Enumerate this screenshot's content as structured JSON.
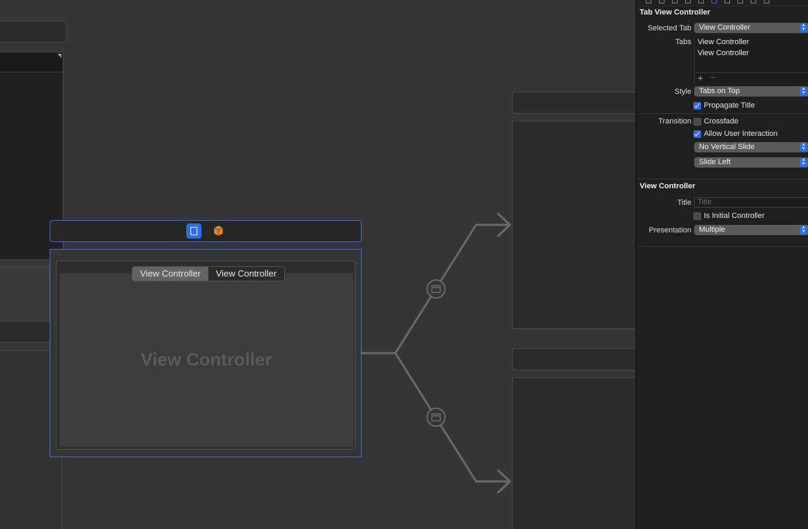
{
  "canvas": {
    "main_scene": {
      "tab_items": [
        "View Controller",
        "View Controller"
      ],
      "selected_tab_index": 0,
      "content_label": "View Controller"
    }
  },
  "inspector": {
    "tab_view_controller": {
      "section_title": "Tab View Controller",
      "selected_tab_label": "Selected Tab",
      "selected_tab_value": "View Controller",
      "tabs_label": "Tabs",
      "tabs": [
        "View Controller",
        "View Controller"
      ],
      "add_symbol": "+",
      "remove_symbol": "−",
      "style_label": "Style",
      "style_value": "Tabs on Top",
      "propagate_title_label": "Propagate Title",
      "propagate_title_checked": true,
      "transition_label": "Transition",
      "crossfade_label": "Crossfade",
      "crossfade_checked": false,
      "allow_user_interaction_label": "Allow User Interaction",
      "allow_user_interaction_checked": true,
      "vertical_slide_value": "No Vertical Slide",
      "horizontal_slide_value": "Slide Left"
    },
    "view_controller": {
      "section_title": "View Controller",
      "title_label": "Title",
      "title_placeholder": "Title",
      "is_initial_label": "Is Initial Controller",
      "is_initial_checked": false,
      "presentation_label": "Presentation",
      "presentation_value": "Multiple"
    }
  },
  "colors": {
    "accent": "#2f6fe4",
    "selection_border": "#3d6ef0",
    "canvas_bg": "#353535",
    "inspector_bg": "#1f1f1f",
    "segue_line": "#6a6a6a"
  },
  "icons": {
    "scene_bar_icons": [
      "view-controller-icon",
      "first-responder-cube-icon"
    ],
    "segue_icons": [
      "relationship-segue-icon",
      "relationship-segue-icon"
    ],
    "popup_icon": "up-down-chevron-icon"
  }
}
